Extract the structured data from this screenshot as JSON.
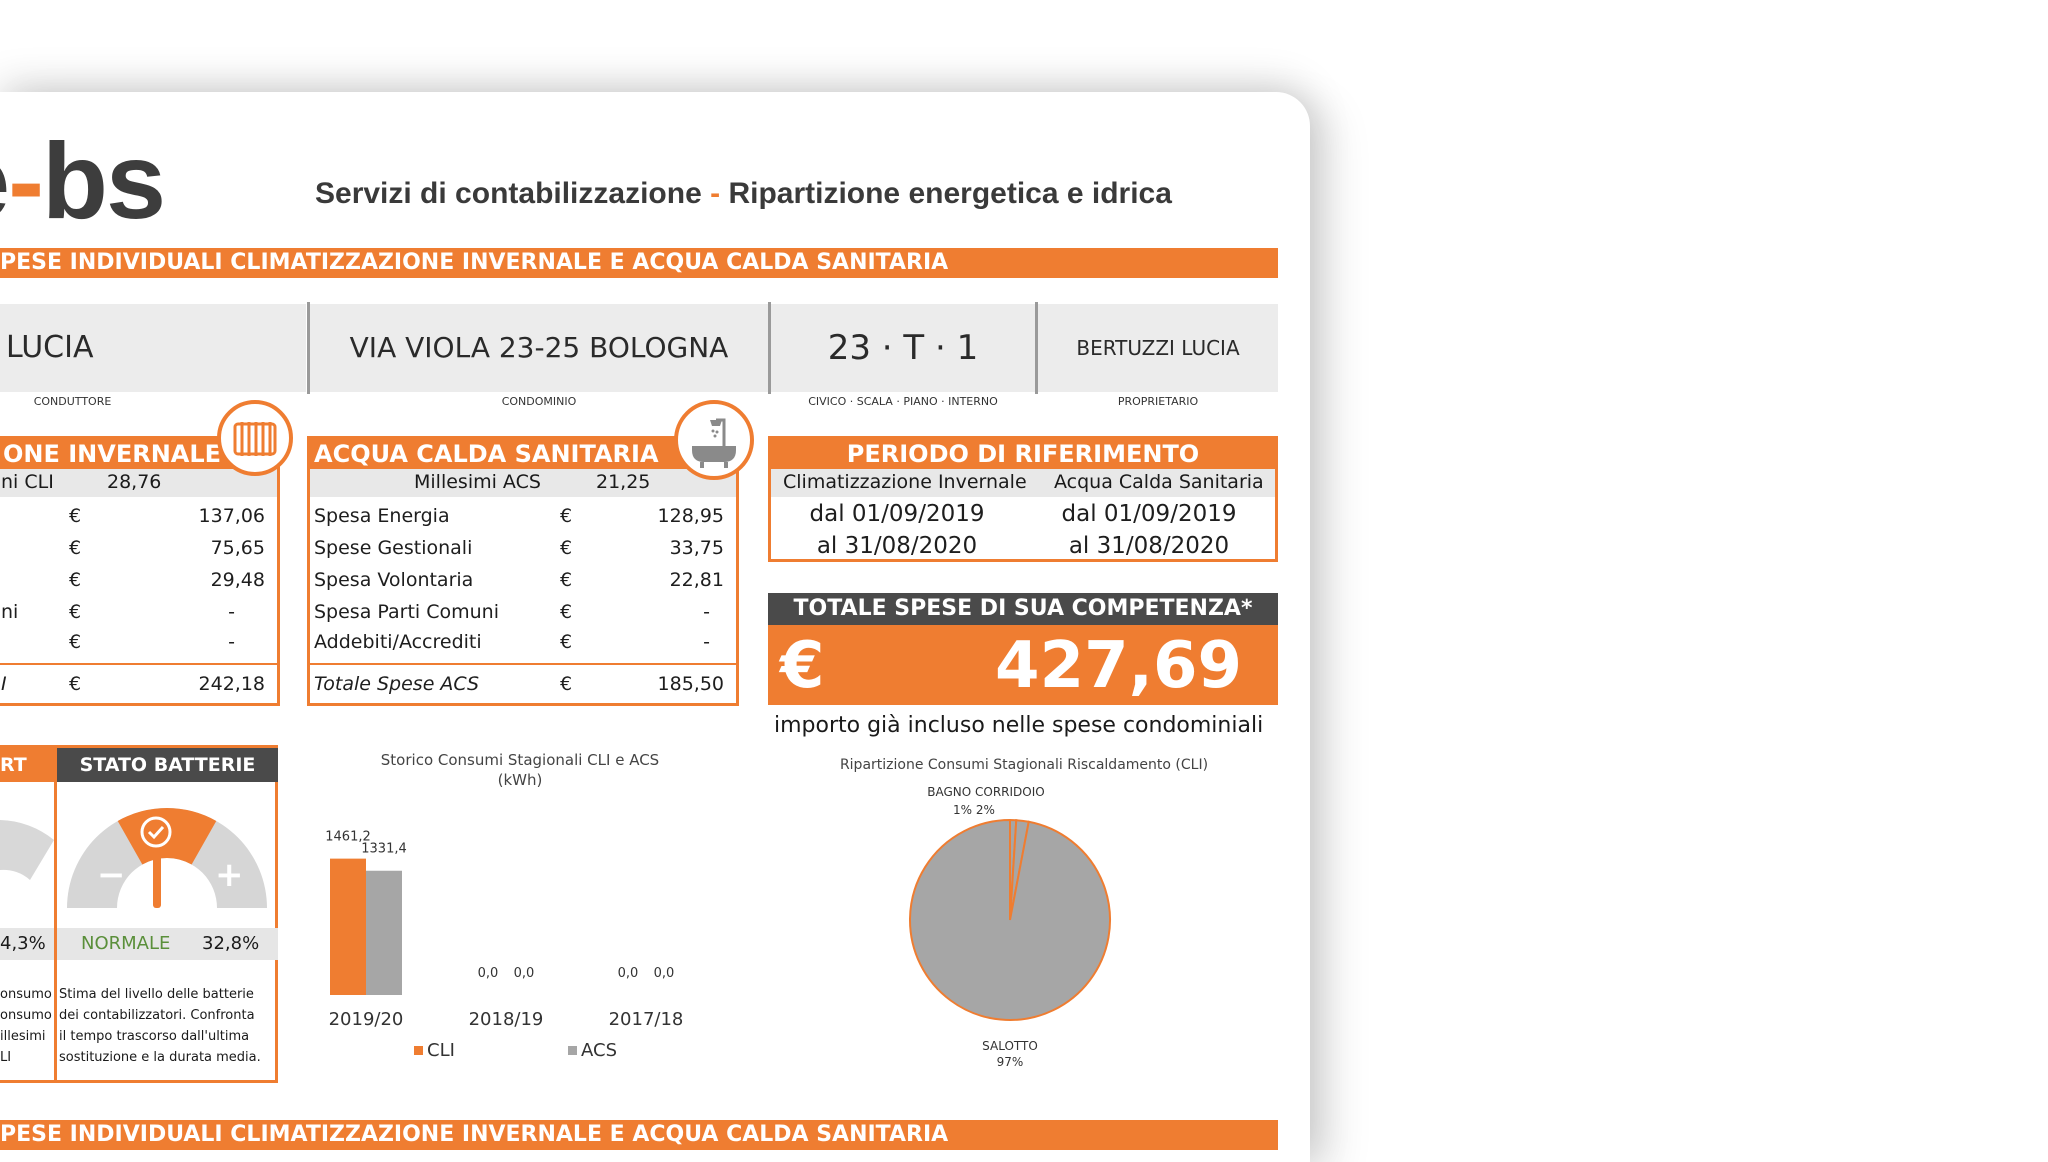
{
  "header": {
    "logo_tail": "e",
    "logo_dash": "-",
    "logo_main": "bs",
    "title_left": "Servizi di contabilizzazione",
    "title_dash": "-",
    "title_right": "Ripartizione energetica e idrica"
  },
  "band_top": "PESE INDIVIDUALI CLIMATIZZAZIONE INVERNALE E ACQUA CALDA SANITARIA",
  "band_bottom": "PESE INDIVIDUALI CLIMATIZZAZIONE INVERNALE E ACQUA CALDA SANITARIA",
  "info": {
    "conduttore": "LUCIA",
    "conduttore_caption": "CONDUTTORE",
    "condominio": "VIA VIOLA 23-25 BOLOGNA",
    "condominio_caption": "CONDOMINIO",
    "civico": "23 · T · 1",
    "civico_caption": "CIVICO · SCALA · PIANO · INTERNO",
    "proprietario": "BERTUZZI LUCIA",
    "proprietario_caption": "PROPRIETARIO"
  },
  "cli": {
    "title": "ONE INVERNALE",
    "millesimi_label": "ni CLI",
    "millesimi_value": "28,76",
    "rows": [
      {
        "label": "",
        "cur": "€",
        "value": "137,06"
      },
      {
        "label": "",
        "cur": "€",
        "value": "75,65"
      },
      {
        "label": "",
        "cur": "€",
        "value": "29,48"
      },
      {
        "label": "ni",
        "cur": "€",
        "value": "-"
      },
      {
        "label": "",
        "cur": "€",
        "value": "-"
      }
    ],
    "total_label": "I",
    "total_cur": "€",
    "total_value": "242,18",
    "icon": "radiator-icon"
  },
  "acs": {
    "title": "ACQUA CALDA SANITARIA",
    "millesimi_label": "Millesimi ACS",
    "millesimi_value": "21,25",
    "rows": [
      {
        "label": "Spesa Energia",
        "cur": "€",
        "value": "128,95"
      },
      {
        "label": "Spese Gestionali",
        "cur": "€",
        "value": "33,75"
      },
      {
        "label": "Spesa Volontaria",
        "cur": "€",
        "value": "22,81"
      },
      {
        "label": "Spesa Parti Comuni",
        "cur": "€",
        "value": "-"
      },
      {
        "label": "Addebiti/Accrediti",
        "cur": "€",
        "value": "-"
      }
    ],
    "total_label": "Totale Spese ACS",
    "total_cur": "€",
    "total_value": "185,50",
    "icon": "bathtub-shower-icon"
  },
  "periodo": {
    "title": "PERIODO DI RIFERIMENTO",
    "col1": "Climatizzazione Invernale",
    "col2": "Acqua Calda Sanitaria",
    "from1": "dal 01/09/2019",
    "from2": "dal 01/09/2019",
    "to1": "al 31/08/2020",
    "to2": "al 31/08/2020"
  },
  "totale": {
    "title": "TOTALE SPESE DI SUA COMPETENZA*",
    "currency": "€",
    "value": "427,69",
    "note": "importo già incluso nelle spese condominiali"
  },
  "alert": {
    "title": "RT",
    "percent": "4,3%",
    "desc": [
      "onsumo",
      "onsumo",
      "illesimi",
      "LI"
    ]
  },
  "batterie": {
    "title": "STATO BATTERIE",
    "status": "NORMALE",
    "percent": "32,8%",
    "minus": "−",
    "plus": "+",
    "desc": [
      "Stima del livello delle batterie",
      "dei contabilizzatori. Confronta",
      "il tempo trascorso dall'ultima",
      "sostituzione e la durata media."
    ],
    "level": 0.328
  },
  "colors": {
    "orange": "#ef7d31",
    "grey": "#a6a6a6",
    "dark": "#4a4a4a",
    "green": "#5a8f3a"
  },
  "chart_data": [
    {
      "type": "bar",
      "title": "Storico Consumi Stagionali CLI e ACS",
      "subtitle": "(kWh)",
      "categories": [
        "2019/20",
        "2018/19",
        "2017/18"
      ],
      "series": [
        {
          "name": "CLI",
          "values": [
            1461.2,
            0.0,
            0.0
          ],
          "labels": [
            "1461,2",
            "0,0",
            "0,0"
          ]
        },
        {
          "name": "ACS",
          "values": [
            1331.4,
            0.0,
            0.0
          ],
          "labels": [
            "1331,4",
            "0,0",
            "0,0"
          ]
        }
      ],
      "legend": "bottom",
      "ylim": [
        0,
        1500
      ]
    },
    {
      "type": "pie",
      "title": "Ripartizione Consumi Stagionali Riscaldamento (CLI)",
      "slices": [
        {
          "name": "SALOTTO",
          "label": "97%",
          "value": 97
        },
        {
          "name": "BAGNO",
          "label": "1%",
          "value": 1
        },
        {
          "name": "CORRIDOIO",
          "label": "2%",
          "value": 2
        }
      ],
      "top_label_names": "BAGNO CORRIDOIO",
      "top_label_values": "1% 2%"
    }
  ]
}
